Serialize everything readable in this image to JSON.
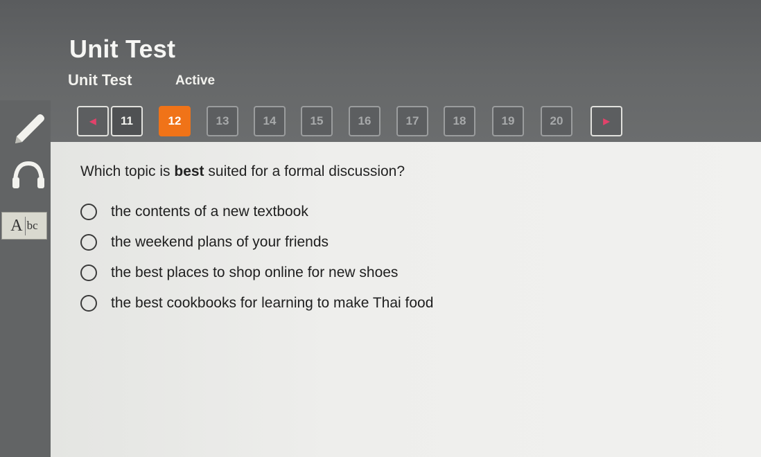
{
  "header": {
    "title": "Unit Test",
    "subtitle": "Unit Test",
    "status": "Active"
  },
  "sidebar": {
    "tools": [
      {
        "icon": "pencil-icon"
      },
      {
        "icon": "headphones-icon"
      },
      {
        "icon": "dictionary-icon",
        "label_a": "A",
        "label_bc": "bc"
      }
    ]
  },
  "pager": {
    "prev_icon": "◀",
    "next_icon": "▶",
    "current": 12,
    "pages": [
      "11",
      "12",
      "13",
      "14",
      "15",
      "16",
      "17",
      "18",
      "19",
      "20"
    ]
  },
  "question": {
    "before": "Which topic is ",
    "emphasis": "best",
    "after": " suited for a formal discussion?"
  },
  "options": [
    "the contents of a new textbook",
    "the weekend plans of your friends",
    "the best places to shop online for new shoes",
    "the best cookbooks for learning to make Thai food"
  ],
  "colors": {
    "current_page": "#f07318",
    "header_bg": "#606263",
    "content_bg": "#eeeeec",
    "arrow": "#e1426a"
  }
}
